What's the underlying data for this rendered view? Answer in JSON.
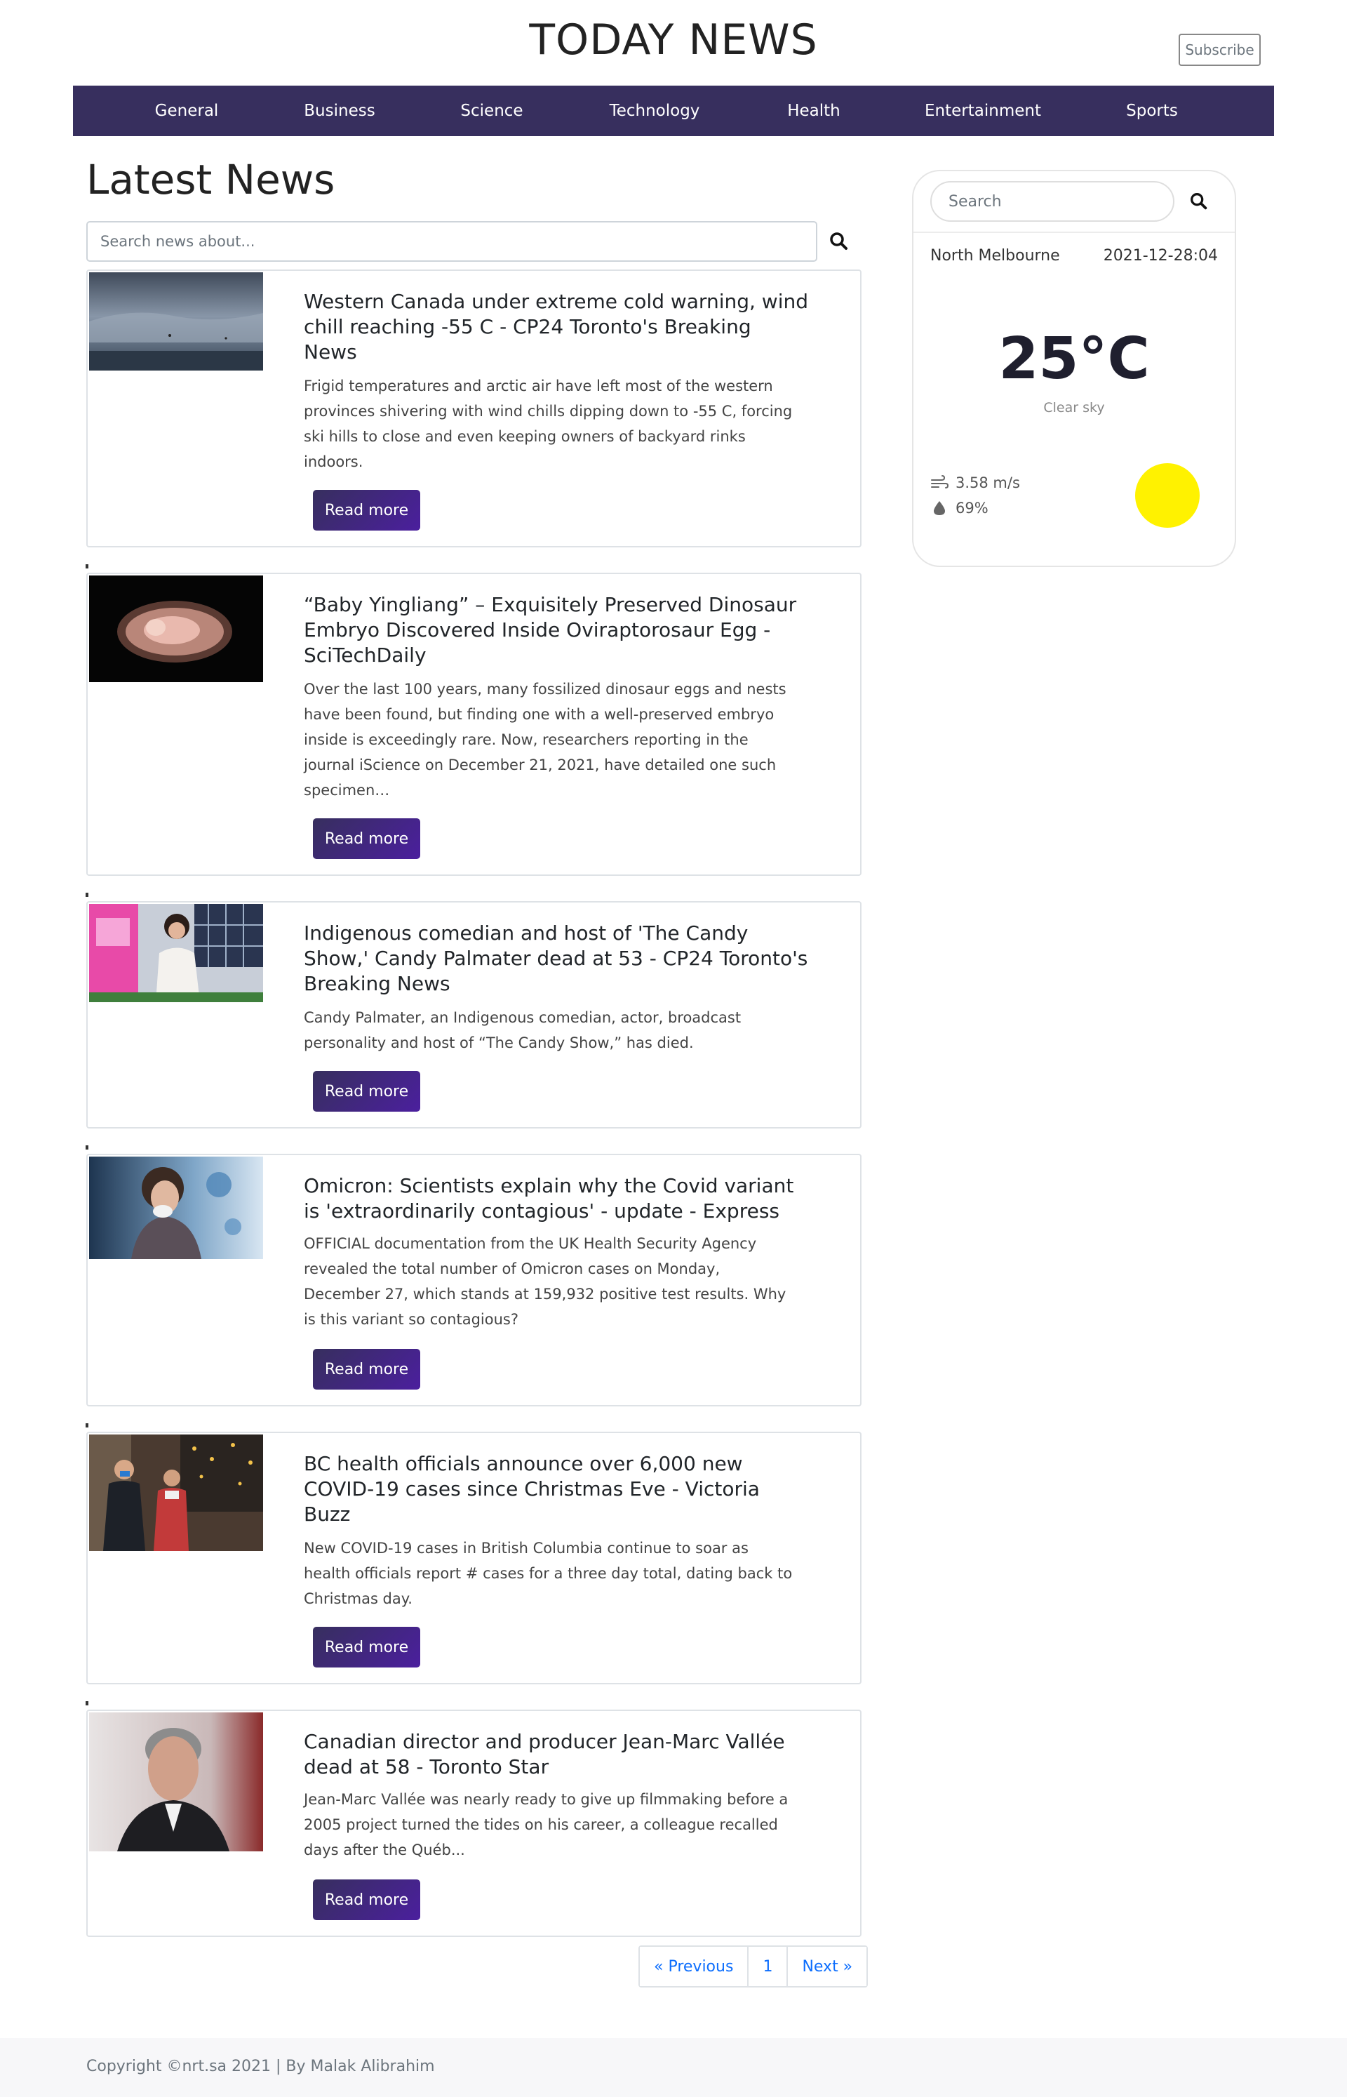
{
  "header": {
    "site_title": "TODAY NEWS",
    "subscribe_label": "Subscribe"
  },
  "nav": {
    "items": [
      {
        "label": "General"
      },
      {
        "label": "Business"
      },
      {
        "label": "Science"
      },
      {
        "label": "Technology"
      },
      {
        "label": "Health"
      },
      {
        "label": "Entertainment"
      },
      {
        "label": "Sports"
      }
    ]
  },
  "main": {
    "title": "Latest News",
    "search_placeholder": "Search news about...",
    "read_more_label": "Read more",
    "articles": [
      {
        "title": "Western Canada under extreme cold warning, wind chill reaching -55 C - CP24 Toronto's Breaking News",
        "description": "Frigid temperatures and arctic air have left most of the western provinces shivering with wind chills dipping down to -55 C, forcing ski hills to close and even keeping owners of backyard rinks indoors."
      },
      {
        "title": "“Baby Yingliang” – Exquisitely Preserved Dinosaur Embryo Discovered Inside Oviraptorosaur Egg - SciTechDaily",
        "description": "Over the last 100 years, many fossilized dinosaur eggs and nests have been found, but finding one with a well-preserved embryo inside is exceedingly rare. Now, researchers reporting in the journal iScience on December 21, 2021, have detailed one such specimen…"
      },
      {
        "title": "Indigenous comedian and host of 'The Candy Show,' Candy Palmater dead at 53 - CP24 Toronto's Breaking News",
        "description": "Candy Palmater, an Indigenous comedian, actor, broadcast personality and host of “The Candy Show,” has died."
      },
      {
        "title": "Omicron: Scientists explain why the Covid variant is 'extraordinarily contagious' - update - Express",
        "description": "OFFICIAL documentation from the UK Health Security Agency revealed the total number of Omicron cases on Monday, December 27, which stands at 159,932 positive test results. Why is this variant so contagious?"
      },
      {
        "title": "BC health officials announce over 6,000 new COVID-19 cases since Christmas Eve - Victoria Buzz",
        "description": "New COVID-19 cases in British Columbia continue to soar as health officials report # cases for a three day total, dating back to Christmas day."
      },
      {
        "title": "Canadian director and producer Jean-Marc Vallée dead at 58 - Toronto Star",
        "description": "Jean-Marc Vallée was nearly ready to give up filmmaking before a 2005 project turned the tides on his career, a colleague recalled days after the Québ..."
      }
    ],
    "pagination": {
      "previous": "« Previous",
      "page": "1",
      "next": "Next »"
    }
  },
  "weather": {
    "search_placeholder": "Search",
    "city": "North Melbourne",
    "date": "2021-12-28:04",
    "temperature": "25°C",
    "condition": "Clear sky",
    "wind": "3.58 m/s",
    "humidity": "69%",
    "sun_color": "#fff200"
  },
  "footer": {
    "copyright": "Copyright ©nrt.sa 2021 | By Malak Alibrahim"
  },
  "colors": {
    "nav_bg": "#372f5e",
    "button_bg": "#4b1f9e",
    "link": "#0d6efd"
  }
}
